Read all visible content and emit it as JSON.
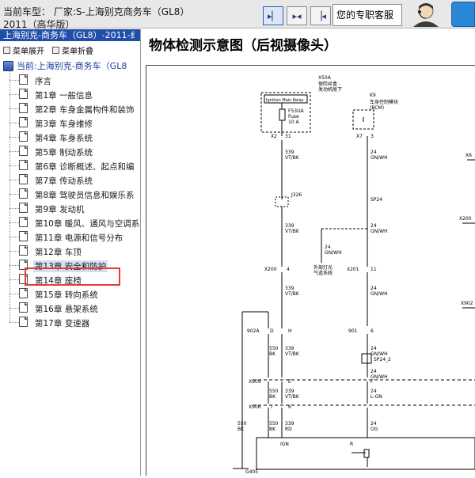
{
  "window": {
    "car_label": "当前车型：  厂家:S-上海别克商务车（GL8）",
    "car_label_sub": "2011（高华版）",
    "support_label": "您的专职客服"
  },
  "nav_buttons": [
    {
      "name": "nav-first-button",
      "glyph": "▸▏"
    },
    {
      "name": "nav-expand-button",
      "glyph": "▸◂"
    },
    {
      "name": "nav-last-button",
      "glyph": "▕◂"
    }
  ],
  "left_panel": {
    "title": "上海别克-商务车（GL8）-2011-纟",
    "toolbar": {
      "expand": "菜单展开",
      "collapse": "菜单折叠"
    },
    "root_label": "当前:上海别克-商务车（GL8",
    "items": [
      {
        "label": "序言"
      },
      {
        "label": "第1章 一般信息"
      },
      {
        "label": "第2章 车身金属构件和装饰"
      },
      {
        "label": "第3章 车身维修"
      },
      {
        "label": "第4章 车身系统"
      },
      {
        "label": "第5章 制动系统"
      },
      {
        "label": "第6章 诊断概述、起点和编"
      },
      {
        "label": "第7章 传动系统"
      },
      {
        "label": "第8章 驾驶员信息和娱乐系"
      },
      {
        "label": "第9章 发动机"
      },
      {
        "label": "第10章 暖风、通风与空调系"
      },
      {
        "label": "第11章 电源和信号分布"
      },
      {
        "label": "第12章 车顶"
      },
      {
        "label": "第13章 安全和防护",
        "selected": true
      },
      {
        "label": "第14章 座椅"
      },
      {
        "label": "第15章 转向系统"
      },
      {
        "label": "第16章 悬架系统"
      },
      {
        "label": "第17章 变速器"
      }
    ]
  },
  "content": {
    "title": "物体检测示意图（后视摄像头）"
  },
  "diagram_labels": {
    "x50a": "X50A",
    "x50a_note1": "保险丝盒 -",
    "x50a_note2": "发动机舱下",
    "relay": "Ignition Main Relay",
    "fuse": "F53UA",
    "fuse2": "Fuse",
    "fuse_rating": "10 A",
    "k9": "K9",
    "k9_note1": "车身控制模块",
    "k9_note2": "(BCM)",
    "x2": "X2",
    "x2_pin": "31",
    "x7": "X7",
    "x7_pin": "3",
    "w1_gauge": "339",
    "w1_color": "VT/BK",
    "w2_gauge": "24",
    "w2_color": "GN/WH",
    "j326": "J326",
    "sp24": "SP24",
    "lamp_note1": "外部灯光",
    "lamp_note2": "气道系统",
    "lamp_gauge": "24",
    "lamp_color": "GN/WH",
    "x200": "X200",
    "x200_pin": "4",
    "x201": "X201",
    "x201_pin": "11",
    "x902a": "902A",
    "pin_d": "D",
    "pin_h": "H",
    "c901": "901",
    "pin_6": "6",
    "w550": "550",
    "w550_color": "BK",
    "sp24_2": "SP24_2",
    "x909": "X909",
    "pin_e": "E",
    "pin_f": "F",
    "x906": "X906",
    "pin_7": "7",
    "pin_6b": "6",
    "lgn": "L-GN",
    "rd": "RD",
    "og": "OG",
    "ign": "IGN",
    "r": "R",
    "g405": "G405",
    "x200r": "X200",
    "x902": "X902",
    "x6": "X6"
  }
}
